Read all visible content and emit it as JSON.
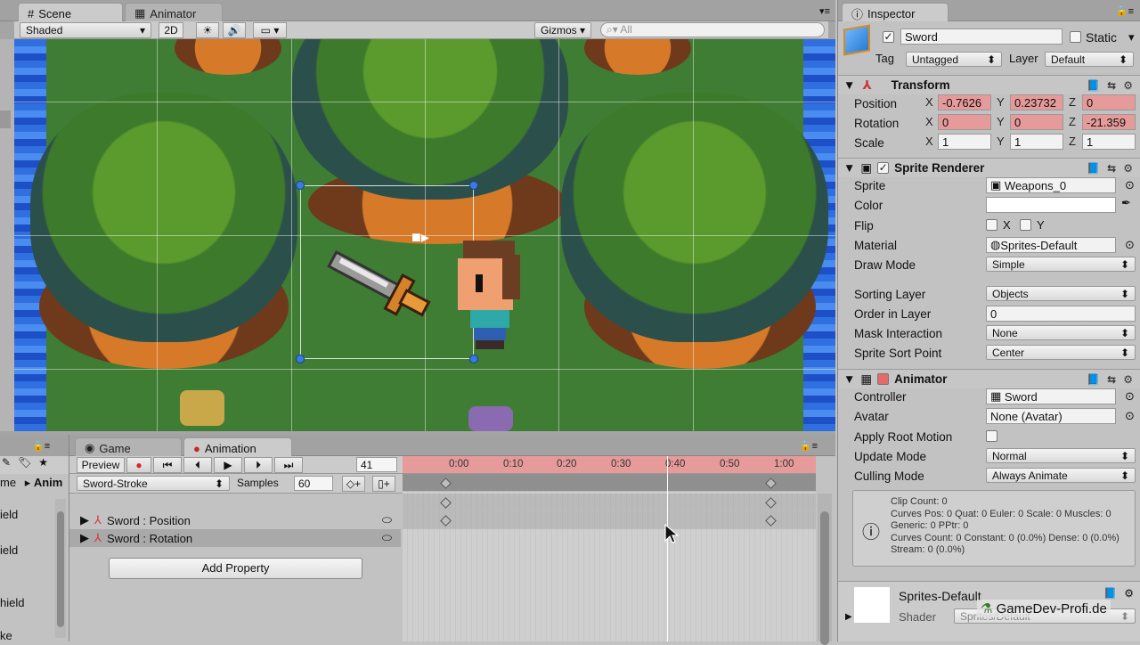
{
  "scene": {
    "tabs": [
      {
        "label": "Scene"
      },
      {
        "label": "Animator"
      }
    ],
    "shading": "Shaded",
    "mode_2d": "2D",
    "gizmos": "Gizmos",
    "search_placeholder": "All"
  },
  "bottom": {
    "tabs": [
      {
        "label": "Game"
      },
      {
        "label": "Animation"
      }
    ],
    "preview": "Preview",
    "frame": "41",
    "clip": "Sword-Stroke",
    "samples_label": "Samples",
    "samples": "60",
    "ticks": [
      "0:00",
      "0:10",
      "0:20",
      "0:30",
      "0:40",
      "0:50",
      "1:00"
    ],
    "properties": [
      {
        "label": "Sword : Position"
      },
      {
        "label": "Sword : Rotation"
      }
    ],
    "add_property": "Add Property",
    "hierarchy_stub": [
      "me",
      "Anim",
      "ield",
      "ield",
      "hield",
      "ke"
    ]
  },
  "inspector": {
    "title": "Inspector",
    "object_name": "Sword",
    "static_label": "Static",
    "tag_label": "Tag",
    "tag": "Untagged",
    "layer_label": "Layer",
    "layer": "Default",
    "transform": {
      "title": "Transform",
      "position_label": "Position",
      "px": "-0.7626",
      "py": "0.23732",
      "pz": "0",
      "rotation_label": "Rotation",
      "rx": "0",
      "ry": "0",
      "rz": "-21.359",
      "scale_label": "Scale",
      "sx": "1",
      "sy": "1",
      "sz": "1"
    },
    "sprite_renderer": {
      "title": "Sprite Renderer",
      "sprite_label": "Sprite",
      "sprite": "Weapons_0",
      "color_label": "Color",
      "flip_label": "Flip",
      "flip_x": "X",
      "flip_y": "Y",
      "material_label": "Material",
      "material": "Sprites-Default",
      "draw_mode_label": "Draw Mode",
      "draw_mode": "Simple",
      "sorting_layer_label": "Sorting Layer",
      "sorting_layer": "Objects",
      "order_label": "Order in Layer",
      "order": "0",
      "mask_label": "Mask Interaction",
      "mask": "None",
      "sort_point_label": "Sprite Sort Point",
      "sort_point": "Center"
    },
    "animator": {
      "title": "Animator",
      "controller_label": "Controller",
      "controller": "Sword",
      "avatar_label": "Avatar",
      "avatar": "None (Avatar)",
      "root_motion_label": "Apply Root Motion",
      "update_label": "Update Mode",
      "update": "Normal",
      "culling_label": "Culling Mode",
      "culling": "Always Animate",
      "info": "Clip Count: 0\nCurves Pos: 0 Quat: 0 Euler: 0 Scale: 0 Muscles: 0 Generic: 0 PPtr: 0\nCurves Count: 0 Constant: 0 (0.0%) Dense: 0 (0.0%) Stream: 0 (0.0%)"
    },
    "material_preview": {
      "name": "Sprites-Default",
      "shader_label": "Shader",
      "shader": "Sprites/Default"
    },
    "watermark": "GameDev-Profi.de"
  }
}
